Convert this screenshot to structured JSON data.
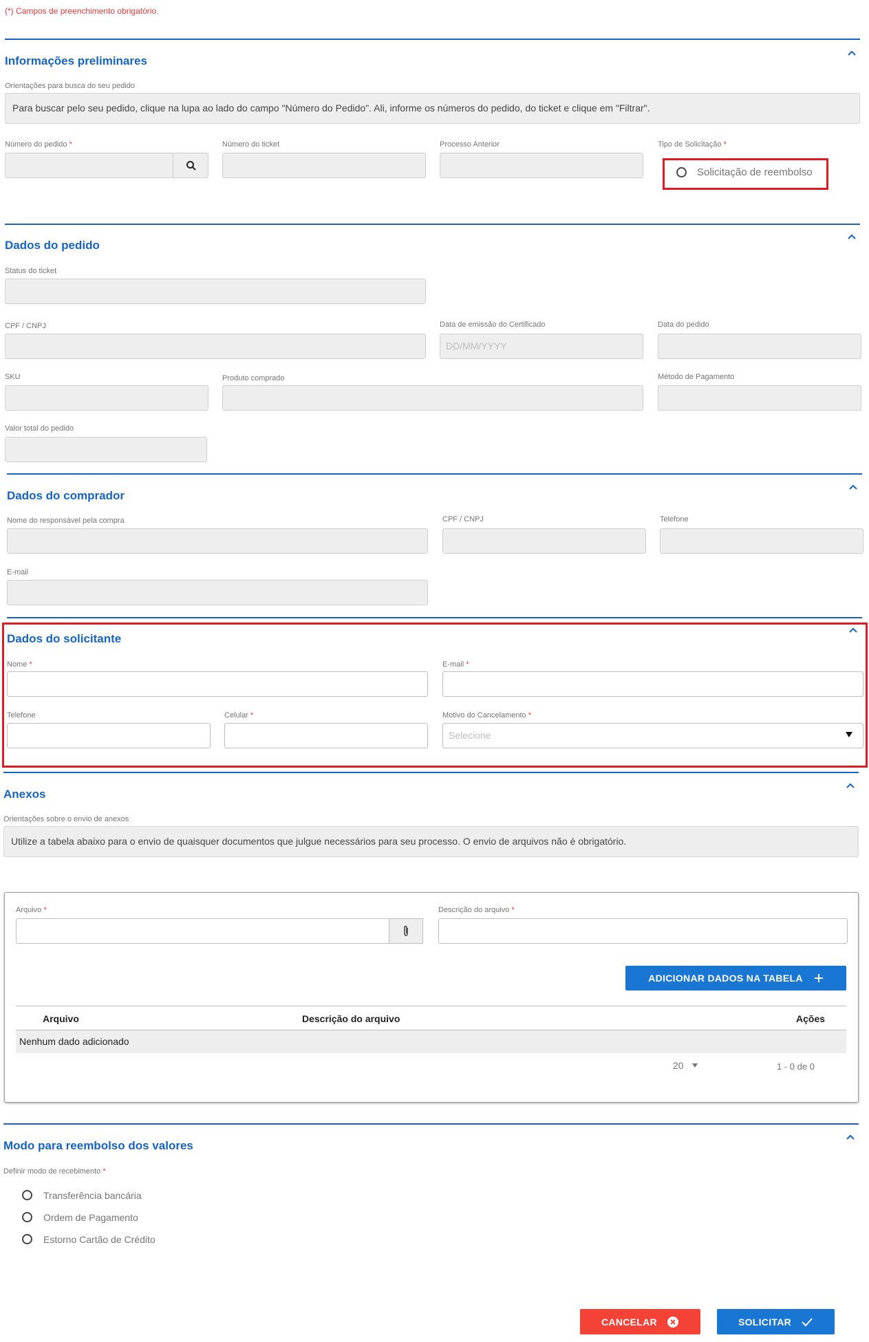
{
  "required_note": "(*) Campos de preenchimento obrigatório.",
  "required_mark": "*",
  "colors": {
    "accent": "#1565c0",
    "danger": "#f44336",
    "highlight": "#e01b24"
  },
  "prelim": {
    "title": "Informações preliminares",
    "guidance_label": "Orientações para busca do seu pedido",
    "guidance_text": "Para buscar pelo seu pedido, clique na lupa ao lado do campo \"Número do Pedido\". Ali, informe os números do pedido, do ticket e clique em \"Filtrar\".",
    "order_number_label": "Número do pedido",
    "ticket_number_label": "Número do ticket",
    "previous_process_label": "Processo Anterior",
    "request_type_label": "Tipo de Solicitação",
    "request_type_option": "Solicitação de reembolso"
  },
  "order": {
    "title": "Dados do pedido",
    "ticket_status_label": "Status do ticket",
    "cpf_cnpj_label": "CPF / CNPJ",
    "cert_date_label": "Data de emissão do Certificado",
    "cert_date_placeholder": "DD/MM/YYYY",
    "order_date_label": "Data do pedido",
    "sku_label": "SKU",
    "product_label": "Produto comprado",
    "payment_method_label": "Método de Pagamento",
    "total_label": "Valor total do pedido"
  },
  "buyer": {
    "title": "Dados do comprador",
    "name_label": "Nome do responsável pela compra",
    "cpf_cnpj_label": "CPF / CNPJ",
    "phone_label": "Telefone",
    "email_label": "E-mail"
  },
  "requester": {
    "title": "Dados do solicitante",
    "name_label": "Nome",
    "email_label": "E-mail",
    "phone_label": "Telefone",
    "mobile_label": "Celular",
    "reason_label": "Motivo do Cancelamento",
    "reason_placeholder": "Selecione"
  },
  "attachments": {
    "title": "Anexos",
    "guidance_label": "Orientações sobre o envio de anexos",
    "guidance_text": "Utilize a tabela abaixo para o envio de quaisquer documentos que julgue necessários para seu processo. O envio de arquivos não é obrigatório.",
    "file_label": "Arquivo",
    "description_label": "Descrição do arquivo",
    "add_button": "ADICIONAR DADOS NA TABELA",
    "columns": [
      "Arquivo",
      "Descrição do arquivo",
      "Ações"
    ],
    "empty_text": "Nenhum dado adicionado",
    "page_size": "20",
    "page_info": "1 - 0 de 0"
  },
  "refund": {
    "title": "Modo para reembolso dos valores",
    "mode_label": "Definir modo de recebimento",
    "options": [
      "Transferência bancária",
      "Ordem de Pagamento",
      "Estorno Cartão de Crédito"
    ]
  },
  "actions": {
    "cancel": "CANCELAR",
    "submit": "SOLICITAR"
  }
}
